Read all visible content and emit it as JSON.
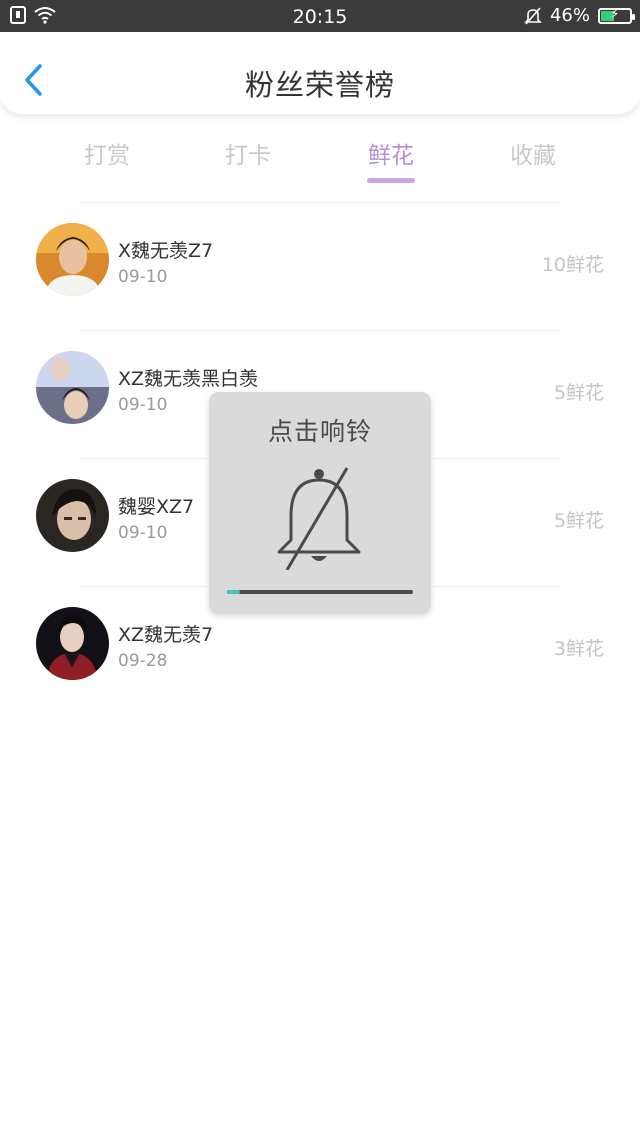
{
  "status_bar": {
    "time": "20:15",
    "battery_text": "46%",
    "battery_level": 0.46,
    "icons": [
      "sim-icon",
      "wifi-icon",
      "mute-bell-icon",
      "battery-icon"
    ],
    "battery_color": "#33d17a"
  },
  "header": {
    "title": "粉丝荣誉榜",
    "back_icon": "chevron-left-icon",
    "accent": "#2196f3"
  },
  "tabs": {
    "items": [
      {
        "label": "打赏"
      },
      {
        "label": "打卡"
      },
      {
        "label": "鲜花"
      },
      {
        "label": "收藏"
      }
    ],
    "active_index": 2,
    "active_color": "#b58ee0"
  },
  "fans": [
    {
      "name": "X魏无羡Z7",
      "date": "09-10",
      "count": "10鲜花"
    },
    {
      "name": "XZ魏无羡黑白羡",
      "date": "09-10",
      "count": "5鲜花"
    },
    {
      "name": "魏婴XZ7",
      "date": "09-10",
      "count": "5鲜花"
    },
    {
      "name": "XZ魏无羡7",
      "date": "09-28",
      "count": "3鲜花"
    }
  ],
  "overlay": {
    "label": "点击响铃",
    "icon": "bell-muted-icon",
    "progress": 0.07,
    "progress_color": "#3bc8b0"
  }
}
